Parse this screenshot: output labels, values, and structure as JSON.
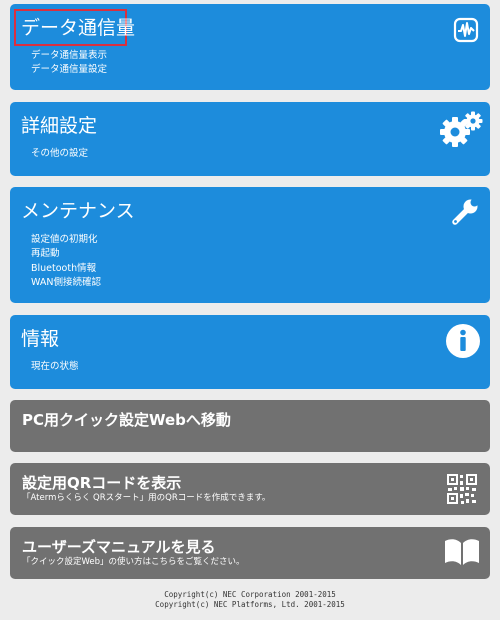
{
  "sections": {
    "data_usage": {
      "title": "データ通信量",
      "links": [
        "データ通信量表示",
        "データ通信量設定"
      ]
    },
    "advanced": {
      "title": "詳細設定",
      "links": [
        "その他の設定"
      ]
    },
    "maintenance": {
      "title": "メンテナンス",
      "links": [
        "設定値の初期化",
        "再起動",
        "Bluetooth情報",
        "WAN側接続確認"
      ]
    },
    "info": {
      "title": "情報",
      "links": [
        "現在の状態"
      ]
    }
  },
  "actions": {
    "pc_quick": {
      "title": "PC用クイック設定Webへ移動"
    },
    "qr": {
      "title": "設定用QRコードを表示",
      "description": "「Atermらくらく QRスタート」用のQRコードを作成できます。"
    },
    "manual": {
      "title": "ユーザーズマニュアルを見る",
      "description": "「クイック設定Web」の使い方はこちらをご覧ください。"
    }
  },
  "footer": {
    "line1": "Copyright(c) NEC Corporation 2001-2015",
    "line2": "Copyright(c) NEC Platforms, Ltd. 2001-2015"
  },
  "icons": {
    "data_usage": "waveform-icon",
    "advanced": "gears-icon",
    "maintenance": "wrench-icon",
    "info": "info-icon",
    "qr": "qr-code-icon",
    "manual": "book-icon"
  },
  "colors": {
    "section_blue": "#1d8cdc",
    "action_gray": "#717171",
    "highlight_red": "#d9303f",
    "background": "#ececec"
  }
}
